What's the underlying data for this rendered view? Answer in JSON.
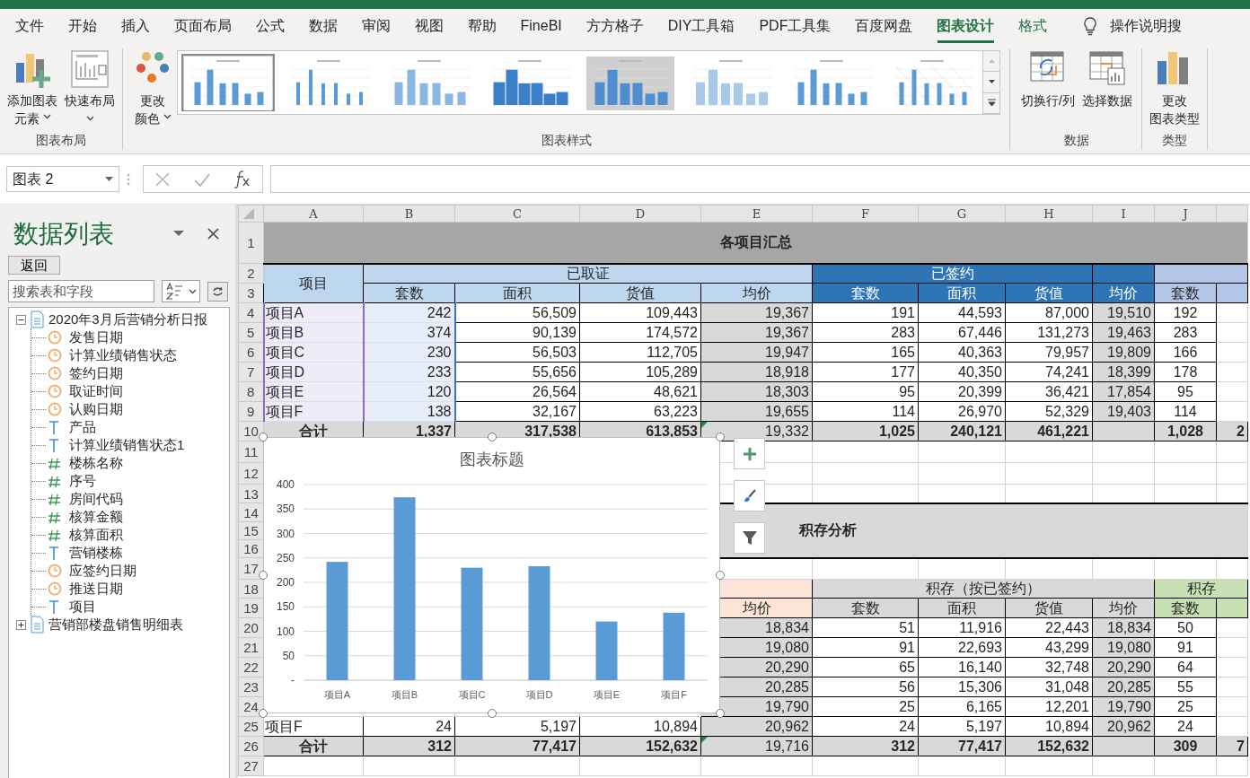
{
  "tabs": [
    {
      "label": "文件",
      "selected": false,
      "contextual": false
    },
    {
      "label": "开始",
      "selected": false,
      "contextual": false
    },
    {
      "label": "插入",
      "selected": false,
      "contextual": false
    },
    {
      "label": "页面布局",
      "selected": false,
      "contextual": false
    },
    {
      "label": "公式",
      "selected": false,
      "contextual": false
    },
    {
      "label": "数据",
      "selected": false,
      "contextual": false
    },
    {
      "label": "审阅",
      "selected": false,
      "contextual": false
    },
    {
      "label": "视图",
      "selected": false,
      "contextual": false
    },
    {
      "label": "帮助",
      "selected": false,
      "contextual": false
    },
    {
      "label": "FineBI",
      "selected": false,
      "contextual": false
    },
    {
      "label": "方方格子",
      "selected": false,
      "contextual": false
    },
    {
      "label": "DIY工具箱",
      "selected": false,
      "contextual": false
    },
    {
      "label": "PDF工具集",
      "selected": false,
      "contextual": false
    },
    {
      "label": "百度网盘",
      "selected": false,
      "contextual": false
    },
    {
      "label": "图表设计",
      "selected": true,
      "contextual": true
    },
    {
      "label": "格式",
      "selected": false,
      "contextual": true
    }
  ],
  "tell_me": {
    "text": "操作说明搜"
  },
  "ribbon": {
    "groups": [
      {
        "label": "图表布局",
        "buttons": [
          {
            "lines": [
              "添加图表",
              "元素"
            ],
            "menu": true
          },
          {
            "lines": [
              "快速布局"
            ],
            "menu": true
          }
        ]
      },
      {
        "label": "图表样式",
        "buttons": [
          {
            "lines": [
              "更改",
              "颜色"
            ],
            "menu": true
          }
        ],
        "gallery": [
          {
            "kind": "plain",
            "selected": true
          },
          {
            "kind": "thin",
            "selected": false
          },
          {
            "kind": "striped",
            "selected": false
          },
          {
            "kind": "shadow",
            "selected": false
          },
          {
            "kind": "dark",
            "selected": false
          },
          {
            "kind": "light",
            "selected": false
          },
          {
            "kind": "plain",
            "selected": false
          },
          {
            "kind": "hatched",
            "selected": false
          }
        ]
      },
      {
        "label": "数据",
        "buttons": [
          {
            "lines": [
              "切换行/列"
            ],
            "menu": false
          },
          {
            "lines": [
              "选择数据"
            ],
            "menu": false
          }
        ]
      },
      {
        "label": "类型",
        "buttons": [
          {
            "lines": [
              "更改",
              "图表类型"
            ],
            "menu": false
          }
        ]
      }
    ]
  },
  "formula_bar": {
    "name_box": "图表 2"
  },
  "panel": {
    "title": "数据列表",
    "back_button": "返回",
    "search": {
      "placeholder": "搜索表和字段"
    },
    "tree": [
      {
        "label": "2020年3月后营销分析日报",
        "expanded": true,
        "children": [
          {
            "label": "发售日期",
            "kind": "date"
          },
          {
            "label": "计算业绩销售状态",
            "kind": "date"
          },
          {
            "label": "签约日期",
            "kind": "date"
          },
          {
            "label": "取证时间",
            "kind": "date"
          },
          {
            "label": "认购日期",
            "kind": "date"
          },
          {
            "label": "产品",
            "kind": "text"
          },
          {
            "label": "计算业绩销售状态1",
            "kind": "text"
          },
          {
            "label": "楼栋名称",
            "kind": "number"
          },
          {
            "label": "序号",
            "kind": "number"
          },
          {
            "label": "房间代码",
            "kind": "number"
          },
          {
            "label": "核算金额",
            "kind": "number"
          },
          {
            "label": "核算面积",
            "kind": "number"
          },
          {
            "label": "营销楼栋",
            "kind": "text"
          },
          {
            "label": "应签约日期",
            "kind": "date"
          },
          {
            "label": "推送日期",
            "kind": "date"
          },
          {
            "label": "项目",
            "kind": "text"
          }
        ]
      },
      {
        "label": "营销部楼盘销售明细表",
        "expanded": false
      }
    ]
  },
  "sheet": {
    "columns": [
      "A",
      "B",
      "C",
      "D",
      "E",
      "F",
      "G",
      "H",
      "I",
      "J"
    ],
    "rows": [
      {
        "number": "1",
        "cells": [
          {
            "text": "各项目汇总",
            "kind": "title"
          }
        ]
      },
      {
        "number": "2",
        "cells": [
          {
            "text": "项目",
            "kind": "corner"
          },
          {
            "text": "已取证",
            "kind": "hl"
          },
          {
            "kind": "merge"
          },
          {
            "kind": "merge"
          },
          {
            "kind": "merge"
          },
          {
            "text": "已签约",
            "kind": "hd"
          },
          {
            "kind": "merge"
          },
          {
            "kind": "merge"
          },
          {
            "kind": "hd"
          },
          {
            "kind": "hv"
          },
          {
            "kind": "merge"
          }
        ]
      },
      {
        "number": "3",
        "cells": [
          {
            "text": "套数",
            "kind": "hl"
          },
          {
            "text": "面积",
            "kind": "hl"
          },
          {
            "text": "货值",
            "kind": "hl"
          },
          {
            "text": "均价",
            "kind": "hl"
          },
          {
            "text": "套数",
            "kind": "hd"
          },
          {
            "text": "面积",
            "kind": "hd"
          },
          {
            "text": "货值",
            "kind": "hd"
          },
          {
            "text": "均价",
            "kind": "hd"
          },
          {
            "text": "套数",
            "kind": "hv"
          },
          {
            "kind": "hv"
          }
        ]
      },
      {
        "number": "4",
        "cells": [
          {
            "text": "项目A",
            "kind": "sel-label"
          },
          {
            "text": "242",
            "kind": "sel-num"
          },
          {
            "text": "56,509",
            "kind": "num"
          },
          {
            "text": "109,443",
            "kind": "num"
          },
          {
            "text": "19,367",
            "kind": "avg"
          },
          {
            "text": "191",
            "kind": "num"
          },
          {
            "text": "44,593",
            "kind": "num"
          },
          {
            "text": "87,000",
            "kind": "num"
          },
          {
            "text": "19,510",
            "kind": "avg"
          },
          {
            "text": "192",
            "kind": "mid"
          },
          {
            "kind": "blank"
          }
        ]
      },
      {
        "number": "5",
        "cells": [
          {
            "text": "项目B",
            "kind": "sel-label"
          },
          {
            "text": "374",
            "kind": "sel-num"
          },
          {
            "text": "90,139",
            "kind": "num"
          },
          {
            "text": "174,572",
            "kind": "num"
          },
          {
            "text": "19,367",
            "kind": "avg"
          },
          {
            "text": "283",
            "kind": "num"
          },
          {
            "text": "67,446",
            "kind": "num"
          },
          {
            "text": "131,273",
            "kind": "num"
          },
          {
            "text": "19,463",
            "kind": "avg"
          },
          {
            "text": "283",
            "kind": "mid"
          },
          {
            "kind": "blank"
          }
        ]
      },
      {
        "number": "6",
        "cells": [
          {
            "text": "项目C",
            "kind": "sel-label"
          },
          {
            "text": "230",
            "kind": "sel-num"
          },
          {
            "text": "56,503",
            "kind": "num"
          },
          {
            "text": "112,705",
            "kind": "num"
          },
          {
            "text": "19,947",
            "kind": "avg"
          },
          {
            "text": "165",
            "kind": "num"
          },
          {
            "text": "40,363",
            "kind": "num"
          },
          {
            "text": "79,957",
            "kind": "num"
          },
          {
            "text": "19,809",
            "kind": "avg"
          },
          {
            "text": "166",
            "kind": "mid"
          },
          {
            "kind": "blank"
          }
        ]
      },
      {
        "number": "7",
        "cells": [
          {
            "text": "项目D",
            "kind": "sel-label"
          },
          {
            "text": "233",
            "kind": "sel-num"
          },
          {
            "text": "55,656",
            "kind": "num"
          },
          {
            "text": "105,289",
            "kind": "num"
          },
          {
            "text": "18,918",
            "kind": "avg"
          },
          {
            "text": "177",
            "kind": "num"
          },
          {
            "text": "40,350",
            "kind": "num"
          },
          {
            "text": "74,241",
            "kind": "num"
          },
          {
            "text": "18,399",
            "kind": "avg"
          },
          {
            "text": "178",
            "kind": "mid"
          },
          {
            "kind": "blank"
          }
        ]
      },
      {
        "number": "8",
        "cells": [
          {
            "text": "项目E",
            "kind": "sel-label"
          },
          {
            "text": "120",
            "kind": "sel-num"
          },
          {
            "text": "26,564",
            "kind": "num"
          },
          {
            "text": "48,621",
            "kind": "num"
          },
          {
            "text": "18,303",
            "kind": "avg"
          },
          {
            "text": "95",
            "kind": "num"
          },
          {
            "text": "20,399",
            "kind": "num"
          },
          {
            "text": "36,421",
            "kind": "num"
          },
          {
            "text": "17,854",
            "kind": "avg"
          },
          {
            "text": "95",
            "kind": "mid"
          },
          {
            "kind": "blank"
          }
        ]
      },
      {
        "number": "9",
        "cells": [
          {
            "text": "项目F",
            "kind": "sel-label"
          },
          {
            "text": "138",
            "kind": "sel-num"
          },
          {
            "text": "32,167",
            "kind": "num"
          },
          {
            "text": "63,223",
            "kind": "num"
          },
          {
            "text": "19,655",
            "kind": "avg"
          },
          {
            "text": "114",
            "kind": "num"
          },
          {
            "text": "26,970",
            "kind": "num"
          },
          {
            "text": "52,329",
            "kind": "num"
          },
          {
            "text": "19,403",
            "kind": "avg"
          },
          {
            "text": "114",
            "kind": "mid"
          },
          {
            "kind": "blank"
          }
        ]
      },
      {
        "number": "10",
        "cells": [
          {
            "text": "合计",
            "kind": "tl"
          },
          {
            "text": "1,337",
            "kind": "tn"
          },
          {
            "text": "317,538",
            "kind": "tn"
          },
          {
            "text": "613,853",
            "kind": "tn"
          },
          {
            "text": "19,332",
            "kind": "tavg",
            "warning": true
          },
          {
            "text": "1,025",
            "kind": "tn"
          },
          {
            "text": "240,121",
            "kind": "tn"
          },
          {
            "text": "461,221",
            "kind": "tn"
          },
          {
            "kind": "tn"
          },
          {
            "text": "1,028",
            "kind": "tmid"
          },
          {
            "text": "2",
            "kind": "tcut"
          }
        ]
      },
      {
        "number": "11"
      },
      {
        "number": "12"
      },
      {
        "number": "13"
      },
      {
        "number": "14",
        "cells": [
          {
            "text": "积存分析",
            "kind": "band"
          },
          {
            "kind": "merge"
          },
          {
            "kind": "merge"
          },
          {
            "kind": "merge"
          },
          {
            "kind": "merge"
          },
          {
            "kind": "merge"
          },
          {
            "kind": "merge"
          }
        ]
      },
      {
        "number": "15"
      },
      {
        "number": "16"
      },
      {
        "number": "17"
      },
      {
        "number": "18",
        "cells": [
          {
            "kind": "peach"
          },
          {
            "text": "积存（按已签约）",
            "kind": "gh"
          },
          {
            "kind": "merge"
          },
          {
            "kind": "merge"
          },
          {
            "kind": "merge"
          },
          {
            "text": "积存",
            "kind": "green"
          },
          {
            "kind": "merge"
          }
        ]
      },
      {
        "number": "19",
        "cells": [
          {
            "text": "均价",
            "kind": "peach"
          },
          {
            "text": "套数",
            "kind": "gh"
          },
          {
            "text": "面积",
            "kind": "gh"
          },
          {
            "text": "货值",
            "kind": "gh"
          },
          {
            "text": "均价",
            "kind": "gh"
          },
          {
            "text": "套数",
            "kind": "green"
          },
          {
            "kind": "green"
          }
        ]
      },
      {
        "number": "20",
        "cells": [
          {
            "text": "18,834",
            "kind": "avg"
          },
          {
            "text": "51",
            "kind": "num"
          },
          {
            "text": "11,916",
            "kind": "num"
          },
          {
            "text": "22,443",
            "kind": "num"
          },
          {
            "text": "18,834",
            "kind": "avg"
          },
          {
            "text": "50",
            "kind": "mid"
          },
          {
            "kind": "blank"
          }
        ]
      },
      {
        "number": "21",
        "cells": [
          {
            "text": "19,080",
            "kind": "avg"
          },
          {
            "text": "91",
            "kind": "num"
          },
          {
            "text": "22,693",
            "kind": "num"
          },
          {
            "text": "43,299",
            "kind": "num"
          },
          {
            "text": "19,080",
            "kind": "avg"
          },
          {
            "text": "91",
            "kind": "mid"
          },
          {
            "kind": "blank"
          }
        ]
      },
      {
        "number": "22",
        "cells": [
          {
            "text": "20,290",
            "kind": "avg"
          },
          {
            "text": "65",
            "kind": "num"
          },
          {
            "text": "16,140",
            "kind": "num"
          },
          {
            "text": "32,748",
            "kind": "num"
          },
          {
            "text": "20,290",
            "kind": "avg"
          },
          {
            "text": "64",
            "kind": "mid"
          },
          {
            "kind": "blank"
          }
        ]
      },
      {
        "number": "23",
        "cells": [
          {
            "text": "20,285",
            "kind": "avg"
          },
          {
            "text": "56",
            "kind": "num"
          },
          {
            "text": "15,306",
            "kind": "num"
          },
          {
            "text": "31,048",
            "kind": "num"
          },
          {
            "text": "20,285",
            "kind": "avg"
          },
          {
            "text": "55",
            "kind": "mid"
          },
          {
            "kind": "blank"
          }
        ]
      },
      {
        "number": "24",
        "cells": [
          {
            "text": "19,790",
            "kind": "avg"
          },
          {
            "text": "25",
            "kind": "num"
          },
          {
            "text": "6,165",
            "kind": "num"
          },
          {
            "text": "12,201",
            "kind": "num"
          },
          {
            "text": "19,790",
            "kind": "avg"
          },
          {
            "text": "25",
            "kind": "mid"
          },
          {
            "kind": "blank"
          }
        ]
      },
      {
        "number": "25",
        "cells": [
          {
            "text": "项目F",
            "kind": "label"
          },
          {
            "text": "24",
            "kind": "num"
          },
          {
            "text": "5,197",
            "kind": "num"
          },
          {
            "text": "10,894",
            "kind": "num"
          },
          {
            "text": "20,962",
            "kind": "avg"
          },
          {
            "text": "24",
            "kind": "num"
          },
          {
            "text": "5,197",
            "kind": "num"
          },
          {
            "text": "10,894",
            "kind": "num"
          },
          {
            "text": "20,962",
            "kind": "avg"
          },
          {
            "text": "24",
            "kind": "mid"
          },
          {
            "kind": "blank"
          }
        ]
      },
      {
        "number": "26",
        "cells": [
          {
            "text": "合计",
            "kind": "tl"
          },
          {
            "text": "312",
            "kind": "tn"
          },
          {
            "text": "77,417",
            "kind": "tn"
          },
          {
            "text": "152,632",
            "kind": "tn"
          },
          {
            "text": "19,716",
            "kind": "tavg",
            "warning": true
          },
          {
            "text": "312",
            "kind": "tn"
          },
          {
            "text": "77,417",
            "kind": "tn"
          },
          {
            "text": "152,632",
            "kind": "tn"
          },
          {
            "kind": "tn"
          },
          {
            "text": "309",
            "kind": "tmid"
          },
          {
            "text": "7",
            "kind": "tcut"
          }
        ]
      },
      {
        "number": "27"
      }
    ],
    "chart": {
      "chart_data": {
        "type": "bar",
        "title": "图表标题",
        "categories": [
          "项目A",
          "项目B",
          "项目C",
          "项目D",
          "项目E",
          "项目F"
        ],
        "series": [
          {
            "color": "#5b9bd5",
            "values": [
              242,
              374,
              230,
              233,
              120,
              138
            ]
          }
        ],
        "ylim": [
          0,
          400
        ],
        "yticks": [
          {
            "value": 0,
            "label": "-"
          },
          50,
          100,
          150,
          200,
          250,
          300,
          350,
          400
        ],
        "grid": true
      }
    }
  }
}
